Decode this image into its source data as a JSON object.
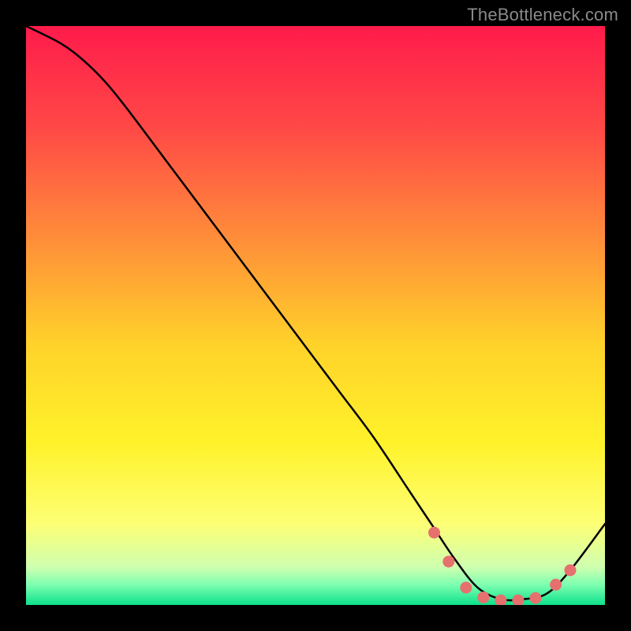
{
  "watermark": "TheBottleneck.com",
  "chart_data": {
    "type": "line",
    "title": "",
    "xlabel": "",
    "ylabel": "",
    "xlim": [
      0,
      100
    ],
    "ylim": [
      0,
      100
    ],
    "grid": false,
    "legend": false,
    "series": [
      {
        "name": "bottleneck-curve",
        "x": [
          0,
          6,
          10,
          14,
          18,
          24,
          30,
          36,
          42,
          48,
          54,
          60,
          66,
          70,
          74,
          78,
          82,
          86,
          90,
          94,
          100
        ],
        "y": [
          100,
          97,
          94,
          90,
          85,
          77,
          69,
          61,
          53,
          45,
          37,
          29,
          20,
          14,
          8,
          3,
          1,
          1,
          2,
          6,
          14
        ]
      }
    ],
    "markers": {
      "name": "highlight-dots",
      "color": "#e6706e",
      "x": [
        70.5,
        73,
        76,
        79,
        82,
        85,
        88,
        91.5,
        94
      ],
      "y": [
        12.5,
        7.5,
        3.0,
        1.3,
        0.8,
        0.8,
        1.2,
        3.5,
        6.0
      ]
    },
    "background_gradient": {
      "stops": [
        {
          "at": 0.0,
          "color": "#ff1b4b"
        },
        {
          "at": 0.18,
          "color": "#ff4a46"
        },
        {
          "at": 0.36,
          "color": "#ff8b3a"
        },
        {
          "at": 0.55,
          "color": "#ffd22a"
        },
        {
          "at": 0.72,
          "color": "#fff22a"
        },
        {
          "at": 0.86,
          "color": "#fdff75"
        },
        {
          "at": 0.935,
          "color": "#cfffb0"
        },
        {
          "at": 0.965,
          "color": "#7dffb0"
        },
        {
          "at": 1.0,
          "color": "#0de08b"
        }
      ]
    }
  }
}
